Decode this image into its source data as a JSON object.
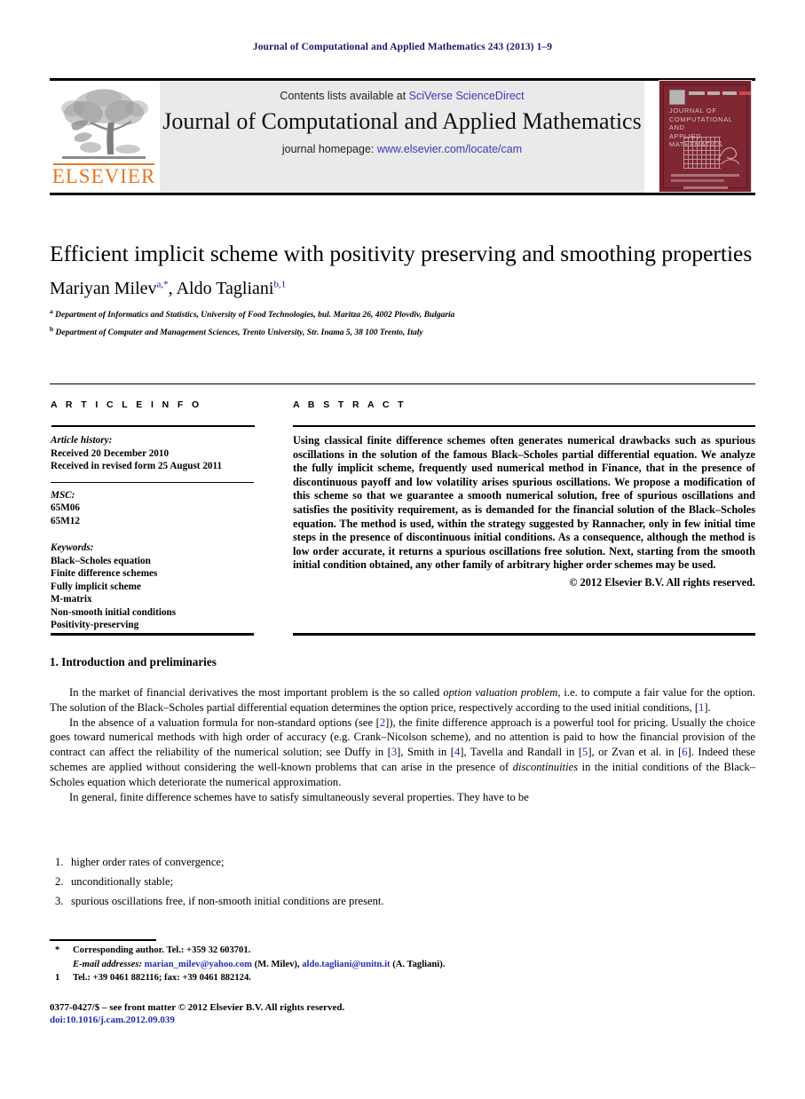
{
  "running_head": "Journal of Computational and Applied Mathematics 243 (2013) 1–9",
  "masthead": {
    "contents_prefix": "Contents lists available at",
    "sciencedirect_link": "SciVerse ScienceDirect",
    "journal_name": "Journal of Computational and Applied Mathematics",
    "homepage_prefix": "journal homepage:",
    "homepage_link": "www.elsevier.com/locate/cam",
    "publisher_wordmark": "ELSEVIER",
    "publisher_color": "#e87722",
    "link_color": "#3a38b8",
    "cover": {
      "line1": "JOURNAL OF",
      "line2": "COMPUTATIONAL AND",
      "line3": "APPLIED MATHEMATICS",
      "background_color": "#7c2230"
    }
  },
  "article": {
    "title": "Efficient implicit scheme with positivity preserving and smoothing properties",
    "authors_html": "Mariyan Milev <sup>a,*</sup>, Aldo Tagliani <sup>b,1</sup>",
    "affiliation_a_mark": "a",
    "affiliation_a": "Department of Informatics and Statistics, University of Food Technologies, bul. Maritza 26, 4002 Plovdiv, Bulgaria",
    "affiliation_b_mark": "b",
    "affiliation_b": "Department of Computer and Management Sciences, Trento University, Str. Inama 5, 38 100 Trento, Italy"
  },
  "article_info": {
    "heading": "A R T I C L E    I N F O",
    "history_label": "Article history:",
    "history": [
      "Received 20 December 2010",
      "Received in revised form 25 August 2011"
    ],
    "msc_label": "MSC:",
    "msc": [
      "65M06",
      "65M12"
    ],
    "keywords_label": "Keywords:",
    "keywords": [
      "Black–Scholes equation",
      "Finite difference schemes",
      "Fully implicit scheme",
      "M-matrix",
      "Non-smooth initial conditions",
      "Positivity-preserving"
    ]
  },
  "abstract": {
    "heading": "A B S T R A C T",
    "body": "Using classical finite difference schemes often generates numerical drawbacks such as spurious oscillations in the solution of the famous Black–Scholes partial differential equation. We analyze the fully implicit scheme, frequently used numerical method in Finance, that in the presence of discontinuous payoff and low volatility arises spurious oscillations. We propose a modification of this scheme so that we guarantee a smooth numerical solution, free of spurious oscillations and satisfies the positivity requirement, as is demanded for the financial solution of the Black–Scholes equation. The method is used, within the strategy suggested by Rannacher, only in few initial time steps in the presence of discontinuous initial conditions. As a consequence, although the method is low order accurate, it returns a spurious oscillations free solution. Next, starting from the smooth initial condition obtained, any other family of arbitrary higher order schemes may be used.",
    "copyright": "© 2012 Elsevier B.V. All rights reserved."
  },
  "body": {
    "section_number": "1.",
    "section_title": "Introduction and preliminaries",
    "paragraph1_a": "In the market of financial derivatives the most important problem is the so called ",
    "paragraph1_em": "option valuation problem",
    "paragraph1_b": ", i.e. to compute a fair value for the option. The solution of the Black–Scholes partial differential equation determines the option price, respectively according to the used initial conditions, [",
    "paragraph1_ref1": "1",
    "paragraph1_c": "].",
    "paragraph2_a": "In the absence of a valuation formula for non-standard options (see [",
    "paragraph2_ref2": "2",
    "paragraph2_b": "]), the finite difference approach is a powerful tool for pricing. Usually the choice goes toward numerical methods with high order of accuracy (e.g. Crank–Nicolson scheme), and no attention is paid to how the financial provision of the contract can affect the reliability of the numerical solution; see Duffy in [",
    "paragraph2_ref3": "3",
    "paragraph2_c": "], Smith in [",
    "paragraph2_ref4": "4",
    "paragraph2_d": "], Tavella and Randall in [",
    "paragraph2_ref5": "5",
    "paragraph2_e": "], or Zvan et al. in [",
    "paragraph2_ref6": "6",
    "paragraph2_f": "]. Indeed these schemes are applied without considering the well-known problems that can arise in the presence of ",
    "paragraph2_em": "discontinuities",
    "paragraph2_g": " in the initial conditions of the Black–Scholes equation which deteriorate the numerical approximation.",
    "paragraph3": "In general, finite difference schemes have to satisfy simultaneously several properties. They have to be",
    "list": [
      {
        "num": "1.",
        "text": "higher order rates of convergence;"
      },
      {
        "num": "2.",
        "text": "unconditionally stable;"
      },
      {
        "num": "3.",
        "text": "spurious oscillations free, if non-smooth initial conditions are present."
      }
    ]
  },
  "footnotes": {
    "star_mark": "*",
    "star_text": "Corresponding author. Tel.: +359 32 603701.",
    "email_label": "E-mail addresses:",
    "email1": "marian_milev@yahoo.com",
    "email1_owner": "(M. Milev),",
    "email2": "aldo.tagliani@unitn.it",
    "email2_owner": "(A. Tagliani).",
    "one_mark": "1",
    "one_text": "Tel.: +39 0461 882116; fax: +39 0461 882124.",
    "issn_line": "0377-0427/$ – see front matter © 2012 Elsevier B.V. All rights reserved.",
    "doi_line": "doi:10.1016/j.cam.2012.09.039"
  }
}
